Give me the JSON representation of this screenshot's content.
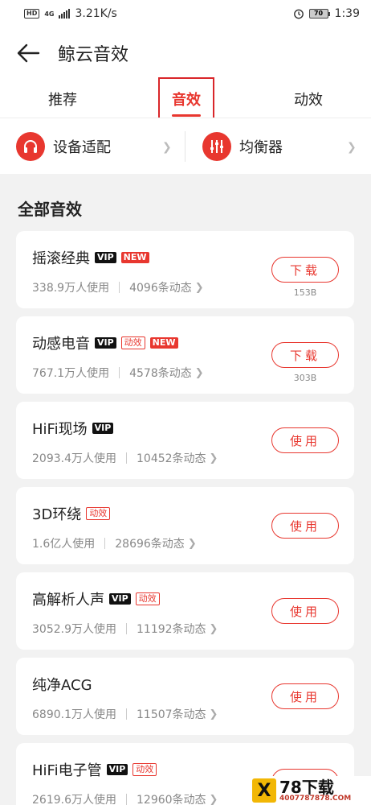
{
  "status_bar": {
    "network_badge": "HD",
    "network_type": "4G",
    "speed": "3.21K/s",
    "battery": "70",
    "time": "1:39"
  },
  "header": {
    "title": "鲸云音效"
  },
  "tabs": [
    {
      "label": "推荐",
      "active": false
    },
    {
      "label": "音效",
      "active": true
    },
    {
      "label": "动效",
      "active": false
    }
  ],
  "quick_entries": [
    {
      "label": "设备适配",
      "icon": "headphones-icon"
    },
    {
      "label": "均衡器",
      "icon": "equalizer-icon"
    }
  ],
  "section": {
    "title": "全部音效"
  },
  "badge_labels": {
    "vip": "VIP",
    "new": "NEW",
    "effect": "动效"
  },
  "effects": [
    {
      "name": "摇滚经典",
      "badges": [
        "vip",
        "new"
      ],
      "users": "338.9万人使用",
      "posts": "4096条动态",
      "action": "下载",
      "size": "153B"
    },
    {
      "name": "动感电音",
      "badges": [
        "vip",
        "effect",
        "new"
      ],
      "users": "767.1万人使用",
      "posts": "4578条动态",
      "action": "下载",
      "size": "303B"
    },
    {
      "name": "HiFi现场",
      "badges": [
        "vip"
      ],
      "users": "2093.4万人使用",
      "posts": "10452条动态",
      "action": "使用",
      "size": ""
    },
    {
      "name": "3D环绕",
      "badges": [
        "effect"
      ],
      "users": "1.6亿人使用",
      "posts": "28696条动态",
      "action": "使用",
      "size": ""
    },
    {
      "name": "高解析人声",
      "badges": [
        "vip",
        "effect"
      ],
      "users": "3052.9万人使用",
      "posts": "11192条动态",
      "action": "使用",
      "size": ""
    },
    {
      "name": "纯净ACG",
      "badges": [],
      "users": "6890.1万人使用",
      "posts": "11507条动态",
      "action": "使用",
      "size": ""
    },
    {
      "name": "HiFi电子管",
      "badges": [
        "vip",
        "effect"
      ],
      "users": "2619.6万人使用",
      "posts": "12960条动态",
      "action": "使用",
      "size": ""
    }
  ],
  "watermark": {
    "main": "78下载",
    "sub": "4007787878.COM"
  },
  "colors": {
    "accent": "#e8372f",
    "background": "#f2f2f2",
    "card": "#ffffff"
  }
}
